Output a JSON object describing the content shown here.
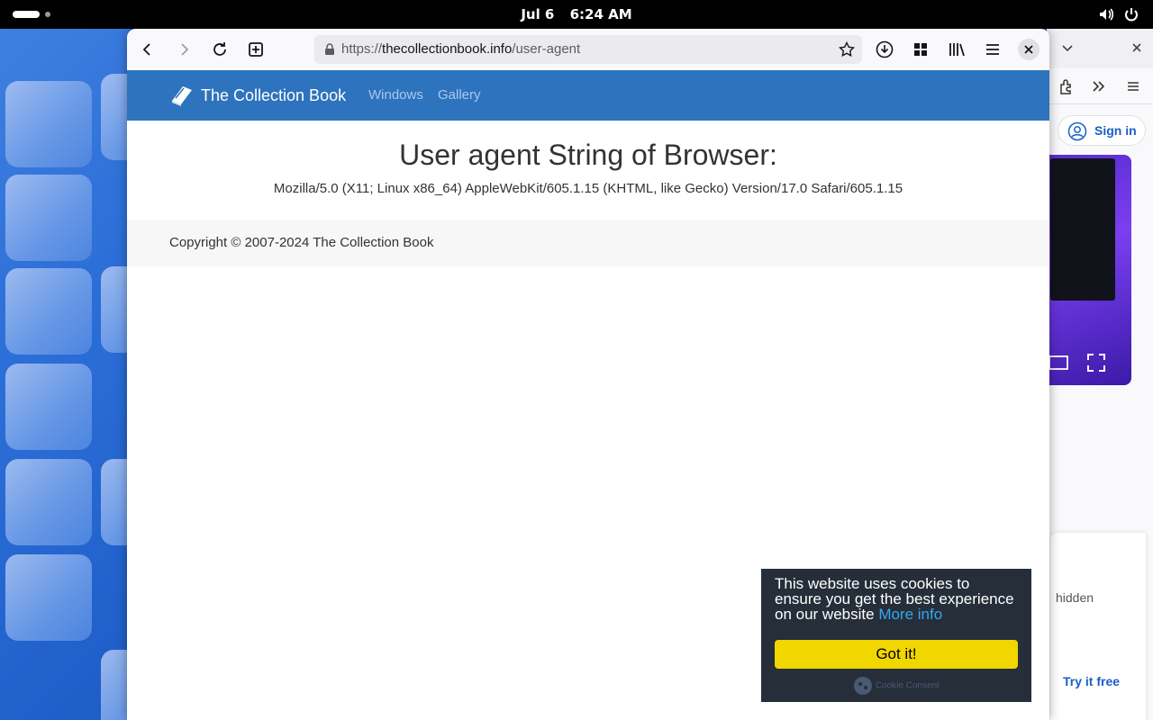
{
  "topbar": {
    "date": "Jul 6",
    "time": "6:24 AM"
  },
  "browser": {
    "url_scheme": "https://",
    "url_host": "thecollectionbook.info",
    "url_path": "/user-agent"
  },
  "site": {
    "brand": "The Collection Book",
    "nav": [
      "Windows",
      "Gallery"
    ],
    "heading": "User agent String of Browser:",
    "user_agent": "Mozilla/5.0 (X11; Linux x86_64) AppleWebKit/605.1.15 (KHTML, like Gecko) Version/17.0 Safari/605.1.15",
    "footer": "Copyright © 2007-2024 The Collection Book"
  },
  "cookie": {
    "message": "This website uses cookies to ensure you get the best experience on our website",
    "link": "More info",
    "button": "Got it!",
    "credit": "Cookie Consent"
  },
  "background_window": {
    "sign_in": "Sign in",
    "partial_text": "hidden",
    "try_free": "Try it free"
  },
  "colors": {
    "nav_bg": "#2e73bd",
    "cookie_bg": "#252e39",
    "cookie_button": "#f1d600",
    "link": "#31a8f0"
  }
}
